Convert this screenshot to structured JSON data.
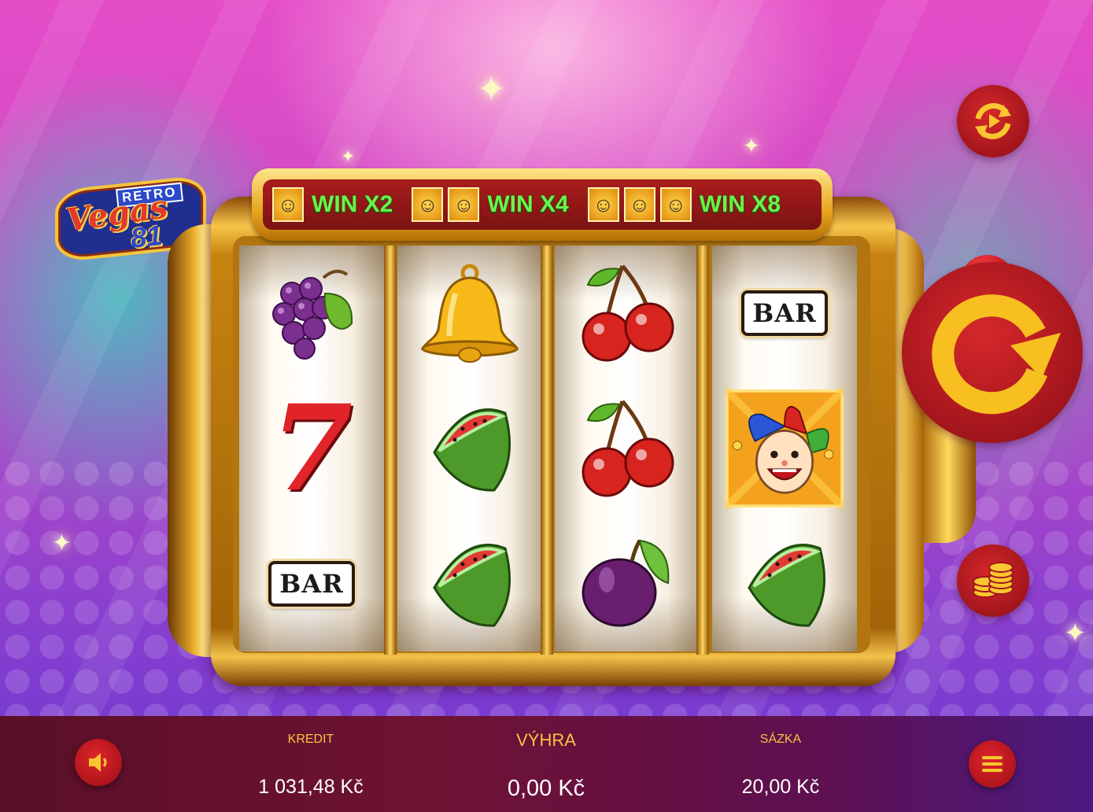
{
  "logo": {
    "retro": "RETRO",
    "vegas": "Vegas",
    "number": "81"
  },
  "win_banner": [
    {
      "label": "WIN X2",
      "jokers": 1
    },
    {
      "label": "WIN X4",
      "jokers": 2
    },
    {
      "label": "WIN X8",
      "jokers": 3
    }
  ],
  "reels": [
    [
      "grapes-icon",
      "seven-icon",
      "bar-icon"
    ],
    [
      "bell-icon",
      "watermelon-icon",
      "watermelon-icon"
    ],
    [
      "cherries-icon",
      "cherries-icon",
      "plum-icon"
    ],
    [
      "bar-icon",
      "joker-icon",
      "watermelon-icon"
    ]
  ],
  "symbols": {
    "bar_label": "BAR",
    "seven_label": "7"
  },
  "controls": {
    "autoplay": "autoplay-icon",
    "spin": "spin-icon",
    "bet_coins": "coins-icon",
    "sound": "speaker-icon",
    "menu": "menu-icon"
  },
  "bottom_bar": {
    "credit_label": "KREDIT",
    "credit_value": "1 031,48 Kč",
    "win_label": "VÝHRA",
    "win_value": "0,00 Kč",
    "bet_label": "SÁZKA",
    "bet_value": "20,00 Kč"
  },
  "colors": {
    "accent_gold": "#f6c443",
    "button_red": "#c41c22",
    "win_green": "#6bf24a",
    "bottom_bar": "#6e1233"
  }
}
